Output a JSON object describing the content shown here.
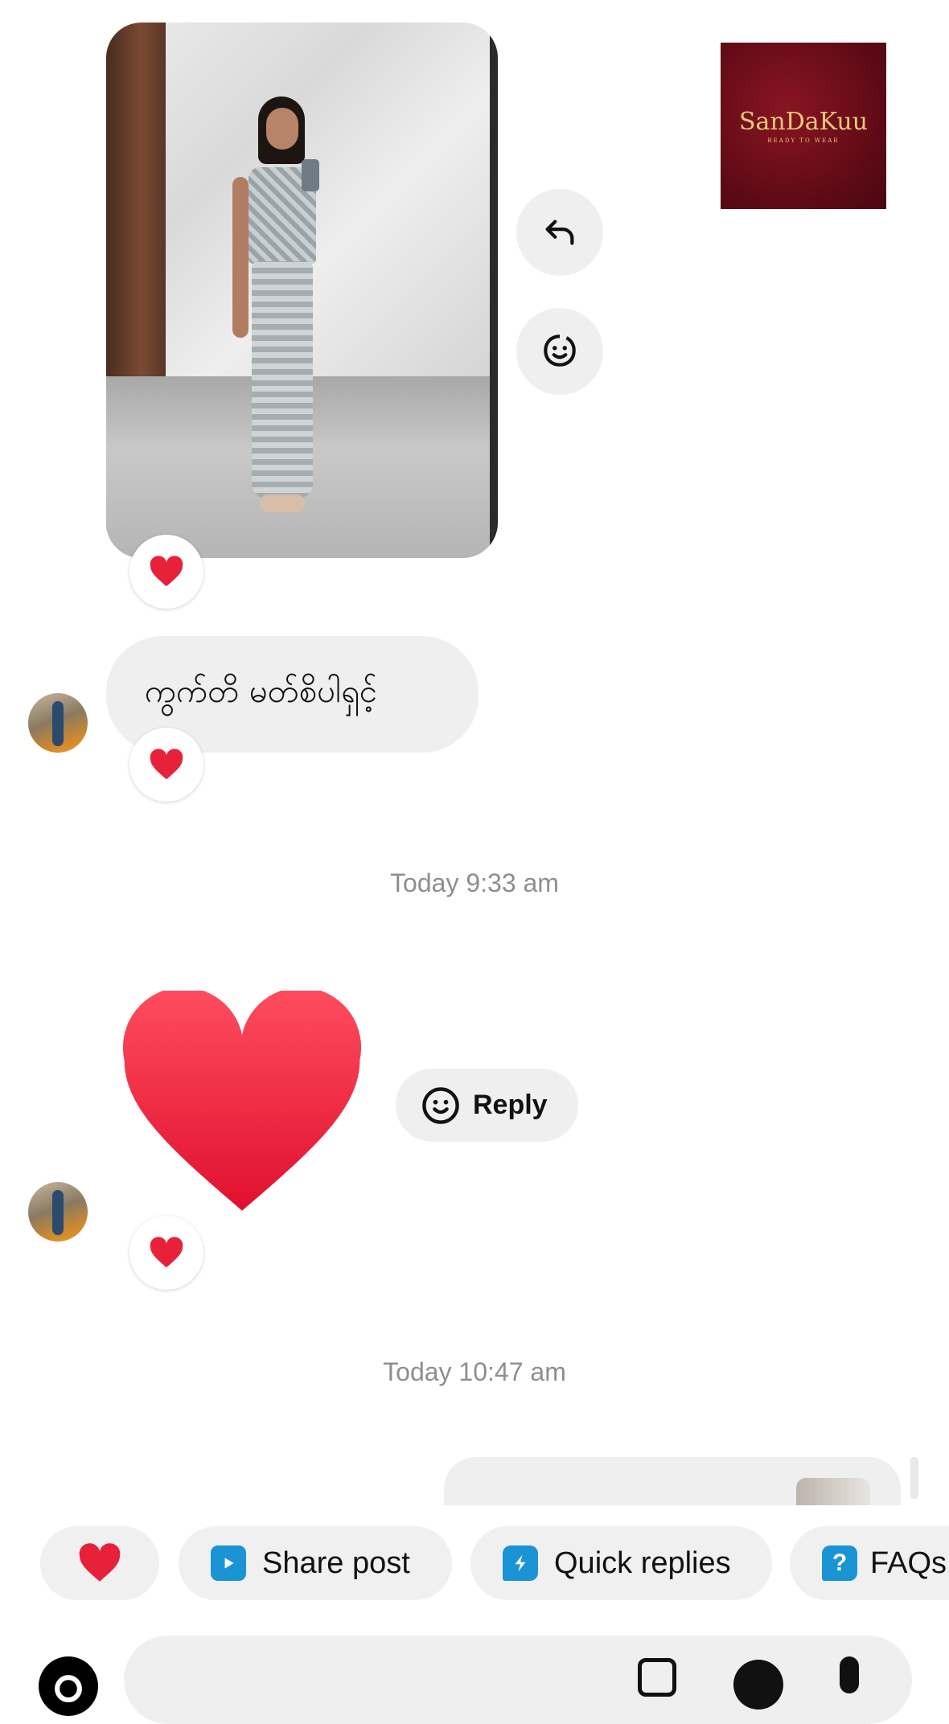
{
  "messages": {
    "text_message": "ကွက်တိ မတ်စိပါရှင့်",
    "timestamp_1": "Today 9:33 am",
    "timestamp_2": "Today 10:47 am",
    "reply_label": "Reply"
  },
  "logo": {
    "brand": "SanDaKuu",
    "tagline": "READY TO WEAR"
  },
  "quick_bar": {
    "chips": [
      {
        "label": "",
        "icon": "heart-icon"
      },
      {
        "label": "Share post",
        "icon": "share-post-icon"
      },
      {
        "label": "Quick replies",
        "icon": "quick-replies-icon"
      },
      {
        "label": "FAQs",
        "icon": "faq-icon"
      }
    ]
  },
  "colors": {
    "heart": "#e8213a",
    "chip_bg": "#f0f0f0",
    "timestamp": "#8e8e8e",
    "share_icon": "#1b94d6",
    "quick_icon": "#1b94d6",
    "logo_bg": "#5c0a15",
    "logo_gold": "#e8c97a"
  }
}
